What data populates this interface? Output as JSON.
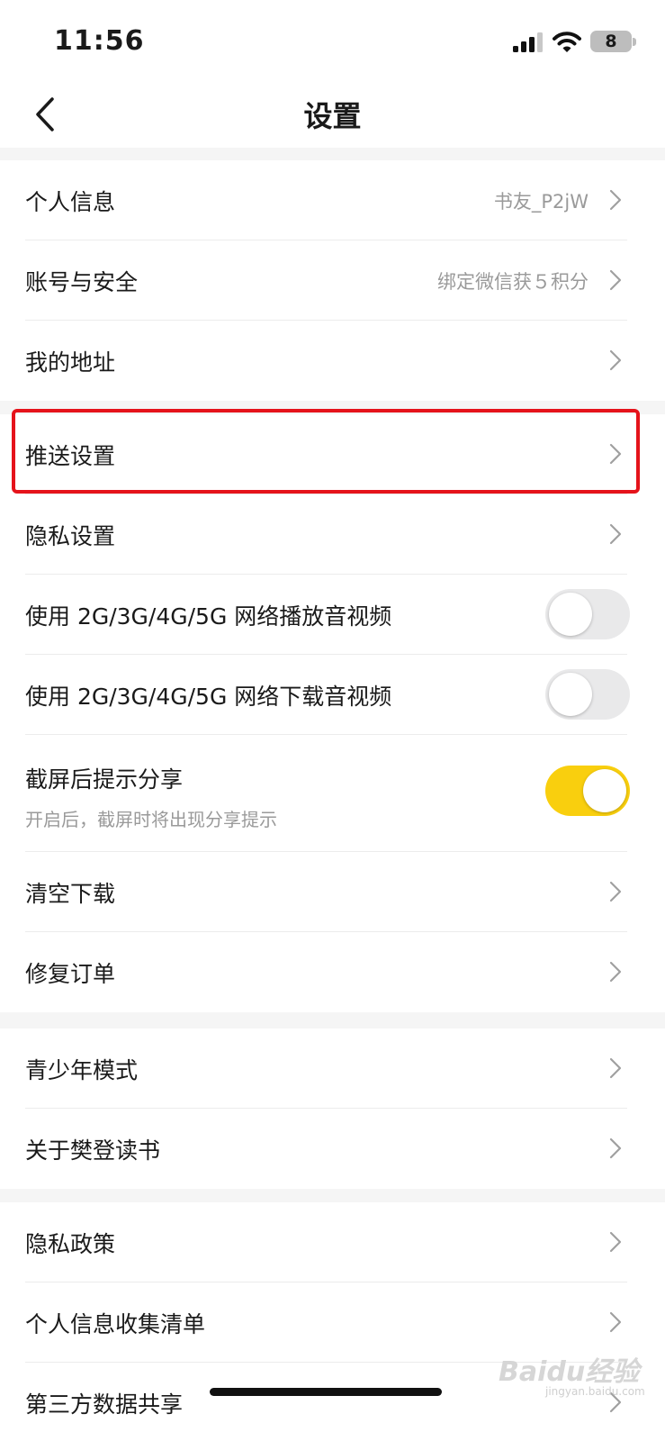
{
  "status_bar": {
    "time": "11:56",
    "battery": "8"
  },
  "header": {
    "title": "设置"
  },
  "sections": [
    [
      {
        "label": "个人信息",
        "value": "书友_P2jW"
      },
      {
        "label": "账号与安全",
        "value": "绑定微信获５积分"
      },
      {
        "label": "我的地址"
      }
    ],
    [
      {
        "label": "推送设置"
      },
      {
        "label": "隐私设置"
      },
      {
        "label": "使用 2G/3G/4G/5G 网络播放音视频",
        "toggle": "off"
      },
      {
        "label": "使用 2G/3G/4G/5G 网络下载音视频",
        "toggle": "off"
      },
      {
        "label": "截屏后提示分享",
        "sublabel": "开启后，截屏时将出现分享提示",
        "toggle": "on"
      },
      {
        "label": "清空下载"
      },
      {
        "label": "修复订单"
      }
    ],
    [
      {
        "label": "青少年模式"
      },
      {
        "label": "关于樊登读书"
      }
    ],
    [
      {
        "label": "隐私政策"
      },
      {
        "label": "个人信息收集清单"
      },
      {
        "label": "第三方数据共享"
      }
    ]
  ],
  "watermark": {
    "text": "Baidu经验",
    "sub": "jingyan.baidu.com"
  },
  "colors": {
    "accent": "#f9cf0e",
    "highlight": "#e5131b",
    "secondary_text": "#9a9a9a"
  }
}
